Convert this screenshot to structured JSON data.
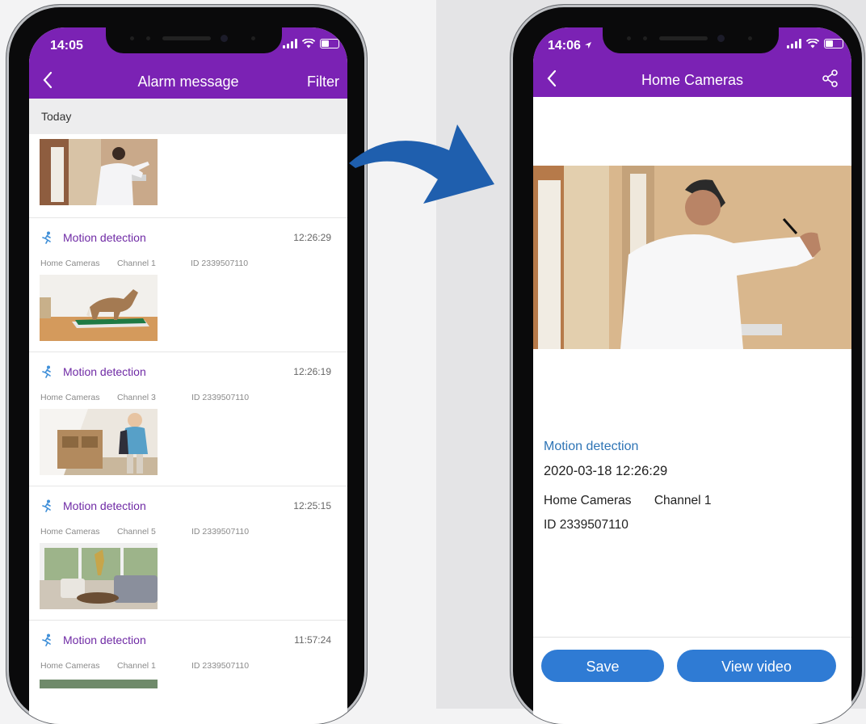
{
  "left_screen": {
    "status_time": "14:05",
    "title": "Alarm message",
    "filter_label": "Filter",
    "date_group": "Today",
    "items": [
      {
        "label": "Motion detection",
        "time": "12:26:29",
        "camera": "Home Cameras",
        "channel": "Channel 1",
        "id": "ID 2339507110"
      },
      {
        "label": "Motion detection",
        "time": "12:26:19",
        "camera": "Home Cameras",
        "channel": "Channel 3",
        "id": "ID 2339507110"
      },
      {
        "label": "Motion detection",
        "time": "12:25:15",
        "camera": "Home Cameras",
        "channel": "Channel 5",
        "id": "ID 2339507110"
      },
      {
        "label": "Motion detection",
        "time": "11:57:24",
        "camera": "Home Cameras",
        "channel": "Channel 1",
        "id": "ID 2339507110"
      }
    ]
  },
  "right_screen": {
    "status_time": "14:06",
    "title": "Home Cameras",
    "event_label": "Motion detection",
    "datetime": "2020-03-18 12:26:29",
    "camera": "Home Cameras",
    "channel": "Channel 1",
    "id": "ID 2339507110",
    "save_label": "Save",
    "view_video_label": "View video"
  },
  "colors": {
    "appbar": "#7b22b4",
    "accent_purple": "#6f2aa5",
    "button_blue": "#2f7bd4",
    "arrow_blue": "#1f5fae",
    "detail_title_blue": "#2e74b5"
  },
  "icons": [
    "back-chevron-icon",
    "share-icon",
    "running-person-icon",
    "signal-icon",
    "wifi-icon",
    "battery-icon",
    "location-arrow-icon"
  ]
}
